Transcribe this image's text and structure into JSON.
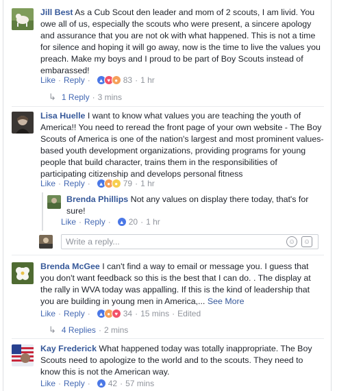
{
  "actions": {
    "like": "Like",
    "reply": "Reply",
    "sep": "·"
  },
  "comments": [
    {
      "name": "Jill Best",
      "text": "As a Cub Scout den leader and mom of 2 scouts, I am livid. You owe all of us, especially the scouts who were present, a sincere apology and assurance that you are not ok with what happened. This is not a time for silence and hoping it will go away, now is the time to live the values you preach. Make my boys and I proud to be part of Boy Scouts instead of embarassed!",
      "reactions": [
        "like",
        "love",
        "angry"
      ],
      "reaction_count": "83",
      "time": "1 hr",
      "replies_link": "1 Reply",
      "replies_time": "3 mins"
    },
    {
      "name": "Lisa Huelle",
      "text": "I want to know what values you are teaching the youth of America!! You need to reread the front page of your own website - The Boy Scouts of America is one of the nation's largest and most prominent values-based youth development organizations, providing programs for young people that build character, trains them in the responsibilities of participating citizenship and develops personal fitness",
      "reactions": [
        "like",
        "angry",
        "sad"
      ],
      "reaction_count": "79",
      "time": "1 hr",
      "reply": {
        "name": "Brenda Phillips",
        "text": "Not any values on display there today, that's for sure!",
        "reactions": [
          "like"
        ],
        "reaction_count": "20",
        "time": "1 hr"
      },
      "reply_box_placeholder": "Write a reply..."
    },
    {
      "name": "Brenda McGee",
      "text": "I can't find a way to email or message you. I guess that you don't want feedback so this is the best that I can do. . The display at the rally in WVA today was appalling. If this is the kind of leadership that you are building in young men in America,...",
      "see_more": "See More",
      "reactions": [
        "like",
        "angry",
        "love"
      ],
      "reaction_count": "34",
      "time": "15 mins",
      "edited": "Edited",
      "replies_link": "4 Replies",
      "replies_time": "2 mins"
    },
    {
      "name": "Kay Frederick",
      "text": "What happened today was totally inappropriate. The Boy Scouts need to apologize to the world and to the scouts. They need to know this is not the American way.",
      "reactions": [
        "like"
      ],
      "reaction_count": "42",
      "time": "57 mins"
    }
  ],
  "colors": {
    "link": "#365899",
    "meta": "#90949c",
    "like": "#4b78e6",
    "love": "#f25268",
    "angry": "#f6a05a",
    "sad": "#f7cf4f"
  }
}
